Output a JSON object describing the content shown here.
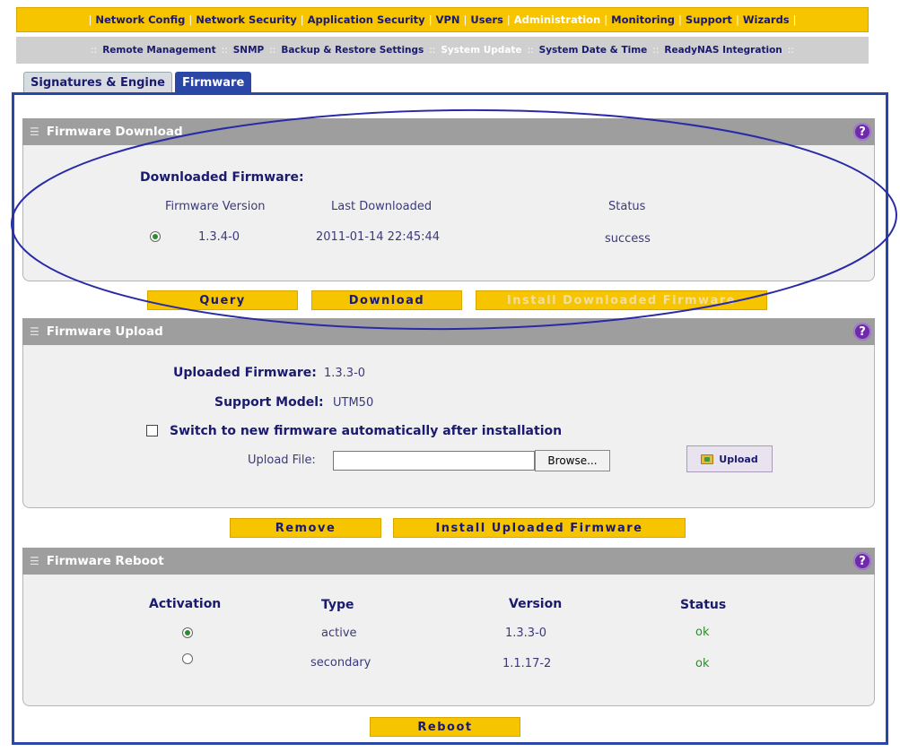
{
  "top_nav": {
    "items": [
      {
        "label": "Network Config",
        "active": false
      },
      {
        "label": "Network Security",
        "active": false
      },
      {
        "label": "Application Security",
        "active": false
      },
      {
        "label": "VPN",
        "active": false
      },
      {
        "label": "Users",
        "active": false
      },
      {
        "label": "Administration",
        "active": true
      },
      {
        "label": "Monitoring",
        "active": false
      },
      {
        "label": "Support",
        "active": false
      },
      {
        "label": "Wizards",
        "active": false
      }
    ]
  },
  "sub_nav": {
    "items": [
      {
        "label": "Remote Management",
        "active": false
      },
      {
        "label": "SNMP",
        "active": false
      },
      {
        "label": "Backup & Restore Settings",
        "active": false
      },
      {
        "label": "System Update",
        "active": true
      },
      {
        "label": "System Date & Time",
        "active": false
      },
      {
        "label": "ReadyNAS Integration",
        "active": false
      }
    ]
  },
  "tabs": [
    {
      "label": "Signatures & Engine",
      "active": false
    },
    {
      "label": "Firmware",
      "active": true
    }
  ],
  "firmware_download": {
    "title": "Firmware Download",
    "subtitle": "Downloaded Firmware:",
    "columns": {
      "version": "Firmware Version",
      "last": "Last Downloaded",
      "status": "Status"
    },
    "row": {
      "version": "1.3.4-0",
      "last": "2011-01-14 22:45:44",
      "status": "success",
      "selected": true
    },
    "buttons": {
      "query": "Query",
      "download": "Download",
      "install": "Install Downloaded Firmware"
    }
  },
  "firmware_upload": {
    "title": "Firmware Upload",
    "uploaded_label": "Uploaded Firmware:",
    "uploaded_value": "1.3.3-0",
    "model_label": "Support Model:",
    "model_value": "UTM50",
    "switch_label": "Switch to new firmware automatically after installation",
    "switch_checked": false,
    "file_label": "Upload File:",
    "file_value": "",
    "browse_label": "Browse...",
    "upload_label": "Upload",
    "buttons": {
      "remove": "Remove",
      "install": "Install Uploaded Firmware"
    }
  },
  "firmware_reboot": {
    "title": "Firmware Reboot",
    "columns": {
      "activation": "Activation",
      "type": "Type",
      "version": "Version",
      "status": "Status"
    },
    "rows": [
      {
        "selected": true,
        "type": "active",
        "version": "1.3.3-0",
        "status": "ok"
      },
      {
        "selected": false,
        "type": "secondary",
        "version": "1.1.17-2",
        "status": "ok"
      }
    ],
    "reboot_label": "Reboot"
  },
  "help_glyph": "?",
  "colors": {
    "nav_yellow": "#f7c400",
    "nav_text": "#1a1a6e",
    "tab_active": "#2a47a8",
    "section_header": "#9e9e9e",
    "annotation_ellipse": "#2a2aa8"
  },
  "icons": {
    "help": "question-circle-icon",
    "section_grip": "grip-icon",
    "upload": "folder-upload-icon"
  }
}
